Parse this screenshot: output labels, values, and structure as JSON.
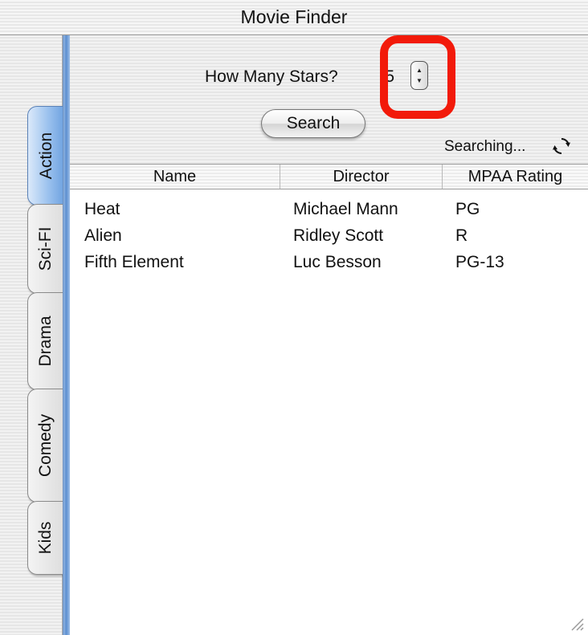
{
  "window": {
    "title": "Movie Finder"
  },
  "tabs": [
    {
      "label": "Action",
      "selected": true
    },
    {
      "label": "Sci-FI",
      "selected": false
    },
    {
      "label": "Drama",
      "selected": false
    },
    {
      "label": "Comedy",
      "selected": false
    },
    {
      "label": "Kids",
      "selected": false
    }
  ],
  "controls": {
    "stars_label": "How Many Stars?",
    "stars_value": "5",
    "search_button": "Search",
    "status_text": "Searching...",
    "highlight_color": "#f21a0a"
  },
  "table": {
    "columns": [
      "Name",
      "Director",
      "MPAA Rating"
    ],
    "rows": [
      [
        "Heat",
        "Michael Mann",
        "PG"
      ],
      [
        "Alien",
        "Ridley Scott",
        "R"
      ],
      [
        "Fifth Element",
        "Luc Besson",
        "PG-13"
      ]
    ]
  },
  "icons": {
    "spinner": "sync-arrows-icon",
    "stepper": "up-down-stepper-icon",
    "resize": "resize-grip-icon"
  }
}
